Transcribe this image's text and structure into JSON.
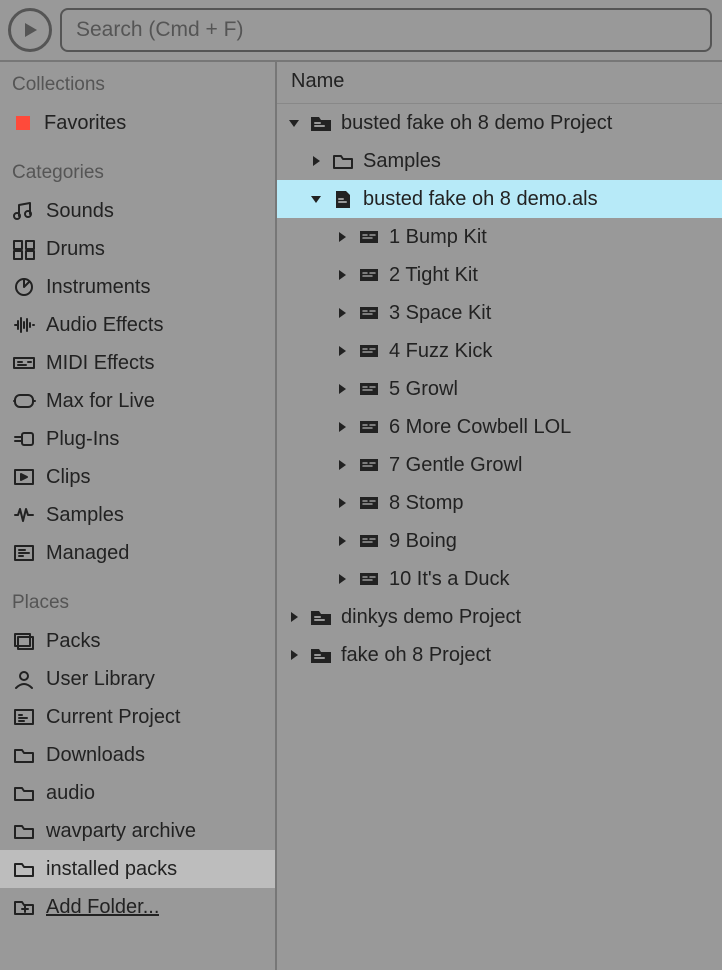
{
  "search": {
    "placeholder": "Search (Cmd + F)"
  },
  "sidebar": {
    "collections": {
      "title": "Collections",
      "favorites": "Favorites"
    },
    "categories": {
      "title": "Categories",
      "items": [
        {
          "label": "Sounds",
          "icon": "sounds-icon"
        },
        {
          "label": "Drums",
          "icon": "drums-icon"
        },
        {
          "label": "Instruments",
          "icon": "instruments-icon"
        },
        {
          "label": "Audio Effects",
          "icon": "audio-effects-icon"
        },
        {
          "label": "MIDI Effects",
          "icon": "midi-effects-icon"
        },
        {
          "label": "Max for Live",
          "icon": "max-for-live-icon"
        },
        {
          "label": "Plug-Ins",
          "icon": "plug-ins-icon"
        },
        {
          "label": "Clips",
          "icon": "clips-icon"
        },
        {
          "label": "Samples",
          "icon": "samples-icon"
        },
        {
          "label": "Managed",
          "icon": "managed-icon"
        }
      ]
    },
    "places": {
      "title": "Places",
      "items": [
        {
          "label": "Packs",
          "icon": "packs-icon",
          "selected": false
        },
        {
          "label": "User Library",
          "icon": "user-library-icon",
          "selected": false
        },
        {
          "label": "Current Project",
          "icon": "current-project-icon",
          "selected": false
        },
        {
          "label": "Downloads",
          "icon": "folder-icon",
          "selected": false
        },
        {
          "label": "audio",
          "icon": "folder-icon",
          "selected": false
        },
        {
          "label": "wavparty archive",
          "icon": "folder-icon",
          "selected": false
        },
        {
          "label": "installed packs",
          "icon": "folder-icon",
          "selected": true
        },
        {
          "label": "Add Folder...",
          "icon": "add-folder-icon",
          "selected": false,
          "add": true
        }
      ]
    }
  },
  "content": {
    "header": "Name",
    "tree": [
      {
        "depth": 0,
        "expanded": true,
        "icon": "project-folder-icon",
        "label": "busted fake oh 8 demo Project"
      },
      {
        "depth": 1,
        "expanded": false,
        "icon": "folder-icon",
        "label": "Samples"
      },
      {
        "depth": 1,
        "expanded": true,
        "selected": true,
        "icon": "als-file-icon",
        "label": "busted fake oh 8 demo.als"
      },
      {
        "depth": 2,
        "expanded": false,
        "icon": "preset-icon",
        "label": "1 Bump Kit"
      },
      {
        "depth": 2,
        "expanded": false,
        "icon": "preset-icon",
        "label": "2 Tight Kit"
      },
      {
        "depth": 2,
        "expanded": false,
        "icon": "preset-icon",
        "label": "3 Space Kit"
      },
      {
        "depth": 2,
        "expanded": false,
        "icon": "preset-icon",
        "label": "4 Fuzz Kick"
      },
      {
        "depth": 2,
        "expanded": false,
        "icon": "preset-icon",
        "label": "5 Growl"
      },
      {
        "depth": 2,
        "expanded": false,
        "icon": "preset-icon",
        "label": "6 More Cowbell LOL"
      },
      {
        "depth": 2,
        "expanded": false,
        "icon": "preset-icon",
        "label": "7 Gentle Growl"
      },
      {
        "depth": 2,
        "expanded": false,
        "icon": "preset-icon",
        "label": "8 Stomp"
      },
      {
        "depth": 2,
        "expanded": false,
        "icon": "preset-icon",
        "label": "9 Boing"
      },
      {
        "depth": 2,
        "expanded": false,
        "icon": "preset-icon",
        "label": "10 It's a Duck"
      },
      {
        "depth": 0,
        "expanded": false,
        "icon": "project-folder-icon",
        "label": "dinkys demo Project"
      },
      {
        "depth": 0,
        "expanded": false,
        "icon": "project-folder-icon",
        "label": "fake oh 8 Project"
      }
    ]
  }
}
